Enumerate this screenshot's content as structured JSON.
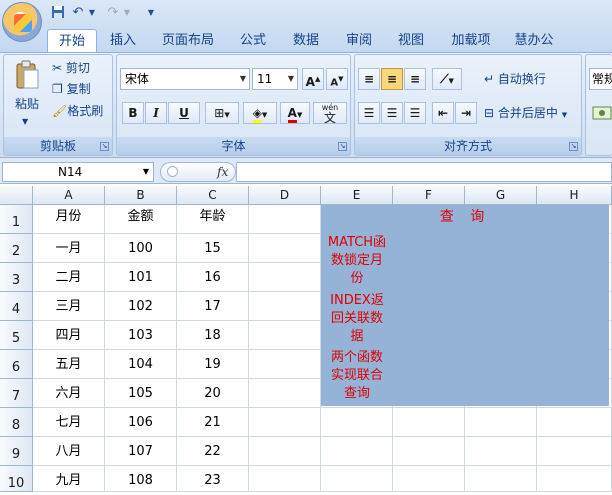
{
  "quick_access": {
    "save": "save-icon",
    "undo": "undo-icon",
    "redo": "redo-icon",
    "customize": "▼"
  },
  "tabs": [
    "开始",
    "插入",
    "页面布局",
    "公式",
    "数据",
    "审阅",
    "视图",
    "加载项",
    "慧办公"
  ],
  "ribbon": {
    "clipboard": {
      "paste": "粘贴",
      "cut": "剪切",
      "copy": "复制",
      "format_painter": "格式刷",
      "label": "剪贴板"
    },
    "font": {
      "font_name": "宋体",
      "font_size": "11",
      "grow": "A",
      "shrink": "A",
      "bold": "B",
      "italic": "I",
      "underline": "U",
      "wen": "wén",
      "wen_char": "文",
      "label": "字体"
    },
    "alignment": {
      "wrap_text": "自动换行",
      "merge_center": "合并后居中",
      "label": "对齐方式"
    },
    "number": {
      "format": "常规"
    }
  },
  "formula_bar": {
    "name_box": "N14",
    "fx": "fx",
    "formula": ""
  },
  "columns": [
    "A",
    "B",
    "C",
    "D",
    "E",
    "F",
    "G",
    "H"
  ],
  "rows": [
    "1",
    "2",
    "3",
    "4",
    "5",
    "6",
    "7",
    "8",
    "9",
    "10"
  ],
  "table": {
    "headers": [
      "月份",
      "金额",
      "年龄"
    ],
    "rows": [
      [
        "一月",
        "100",
        "15"
      ],
      [
        "二月",
        "101",
        "16"
      ],
      [
        "三月",
        "102",
        "17"
      ],
      [
        "四月",
        "103",
        "18"
      ],
      [
        "五月",
        "104",
        "19"
      ],
      [
        "六月",
        "105",
        "20"
      ],
      [
        "七月",
        "106",
        "21"
      ],
      [
        "八月",
        "107",
        "22"
      ],
      [
        "九月",
        "108",
        "23"
      ]
    ]
  },
  "lookup_panel": {
    "title": "查 询",
    "note1": [
      "MATCH函",
      "数锁定月",
      "份"
    ],
    "note2": [
      "INDEX返",
      "回关联数",
      "据"
    ],
    "note3": [
      "两个函数",
      "实现联合",
      "查询"
    ],
    "fill_color": "#95b3d7",
    "text_color": "#e00000"
  }
}
